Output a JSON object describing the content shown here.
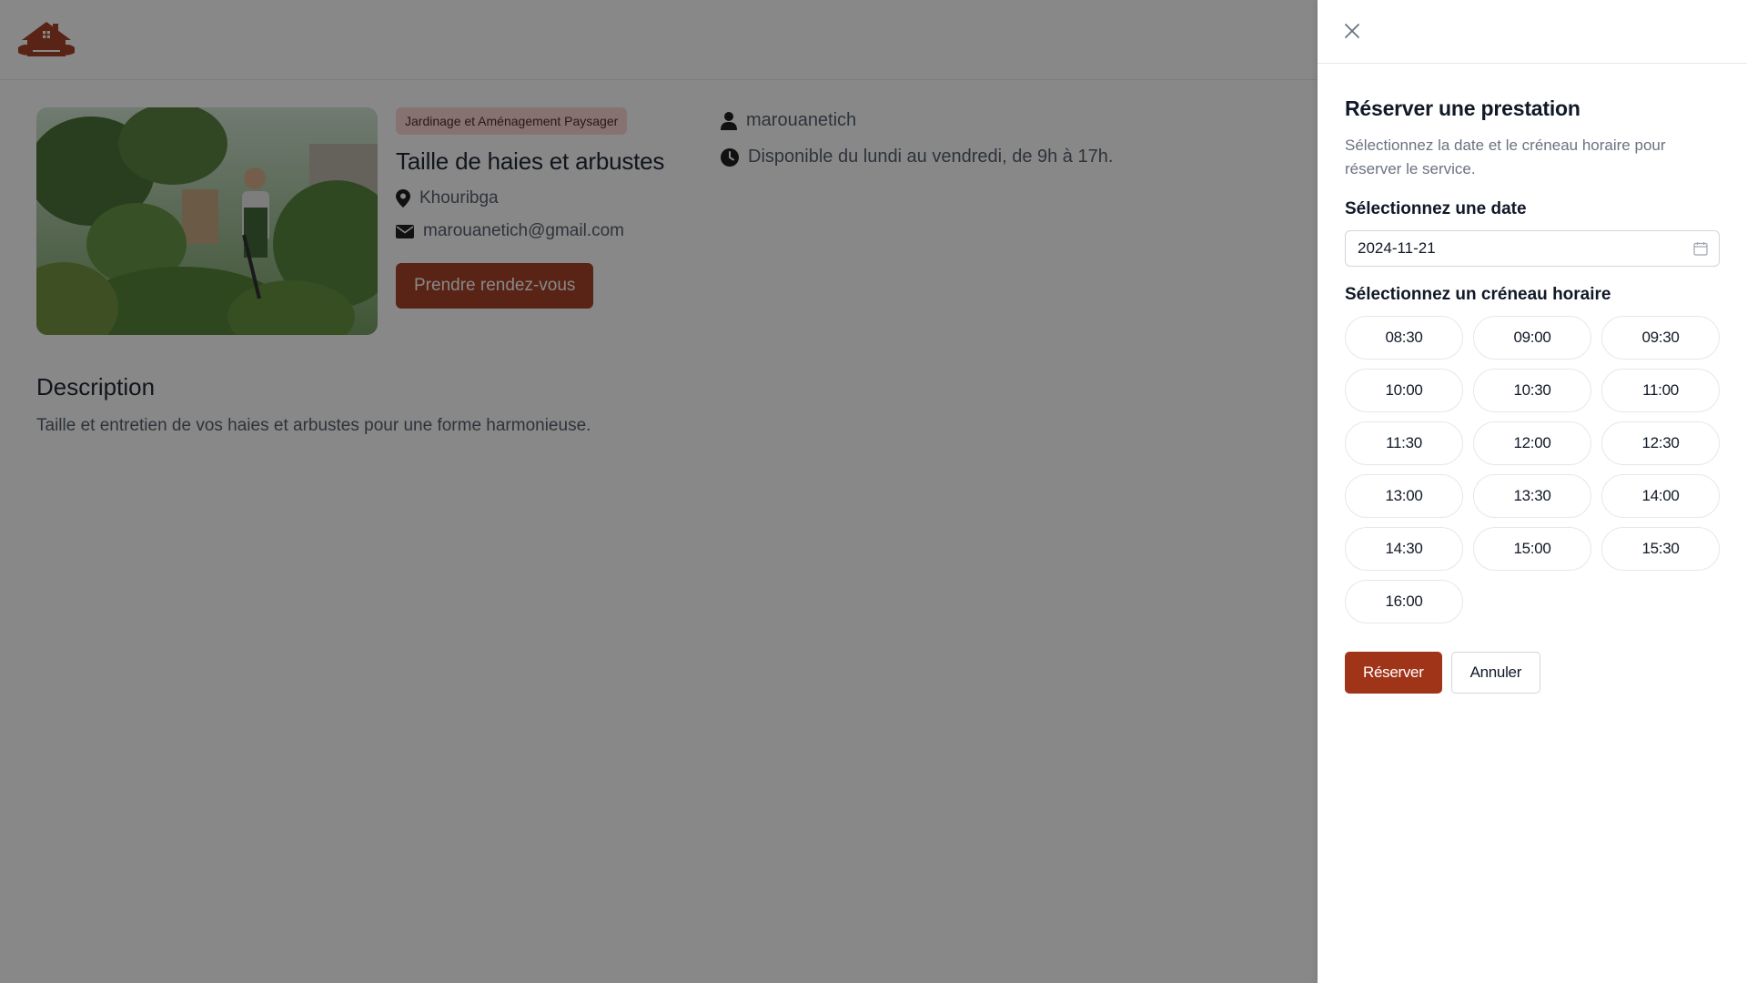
{
  "service": {
    "category": "Jardinage et Aménagement Paysager",
    "title": "Taille de haies et arbustes",
    "location": "Khouribga",
    "email": "marouanetich@gmail.com",
    "cta_label": "Prendre rendez-vous",
    "provider": "marouanetich",
    "availability": "Disponible du lundi au vendredi, de 9h à 17h."
  },
  "description": {
    "heading": "Description",
    "text": "Taille et entretien de vos haies et arbustes pour une forme harmonieuse."
  },
  "drawer": {
    "title": "Réserver une prestation",
    "subtitle": "Sélectionnez la date et le créneau horaire pour réserver le service.",
    "date_label": "Sélectionnez une date",
    "date_value": "2024-11-21",
    "slot_label": "Sélectionnez un créneau horaire",
    "slots": [
      "08:30",
      "09:00",
      "09:30",
      "10:00",
      "10:30",
      "11:00",
      "11:30",
      "12:00",
      "12:30",
      "13:00",
      "13:30",
      "14:00",
      "14:30",
      "15:00",
      "15:30",
      "16:00"
    ],
    "reserve_label": "Réserver",
    "cancel_label": "Annuler"
  },
  "colors": {
    "brand": "#a03418",
    "badge_bg": "#fbd5d0",
    "overlay": "rgba(17,17,17,0.5)"
  },
  "icons": {
    "logo": "house-logo-icon",
    "close": "close-icon",
    "location": "map-pin-icon",
    "email": "envelope-icon",
    "user": "user-icon",
    "clock": "clock-icon",
    "calendar": "calendar-icon"
  }
}
